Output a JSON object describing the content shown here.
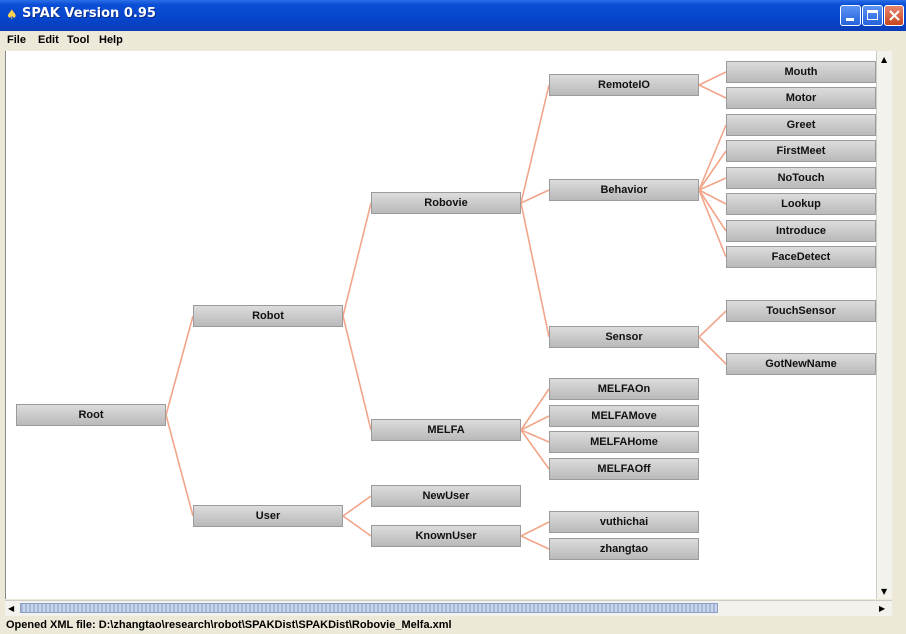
{
  "window": {
    "title": "SPAK Version 0.95"
  },
  "menu": [
    "File",
    "Edit",
    "Tool",
    "Help"
  ],
  "tree": {
    "root": "Root",
    "robot": "Robot",
    "user": "User",
    "robovie": "Robovie",
    "melfa": "MELFA",
    "newuser": "NewUser",
    "knownuser": "KnownUser",
    "remoteio": "RemoteIO",
    "behavior": "Behavior",
    "sensor": "Sensor",
    "mouth": "Mouth",
    "motor": "Motor",
    "greet": "Greet",
    "firstmeet": "FirstMeet",
    "notouch": "NoTouch",
    "lookup": "Lookup",
    "introduce": "Introduce",
    "facedetect": "FaceDetect",
    "touchsensor": "TouchSensor",
    "gotnewname": "GotNewName",
    "melfaon": "MELFAOn",
    "melfamove": "MELFAMove",
    "melfahome": "MELFAHome",
    "melfaoff": "MELFAOff",
    "vuthichai": "vuthichai",
    "zhangtao": "zhangtao"
  },
  "status": {
    "text": "Opened XML file: D:\\zhangtao\\research\\robot\\SPAKDist\\SPAKDist\\Robovie_Melfa.xml"
  },
  "colors": {
    "edge": "#f2a58a",
    "node_fill": "#c8c8c8",
    "titlebar": "#0a4fd6"
  },
  "icons": {
    "app": "spak-app-icon",
    "minimize": "minimize-icon",
    "maximize": "maximize-icon",
    "close": "close-icon"
  }
}
